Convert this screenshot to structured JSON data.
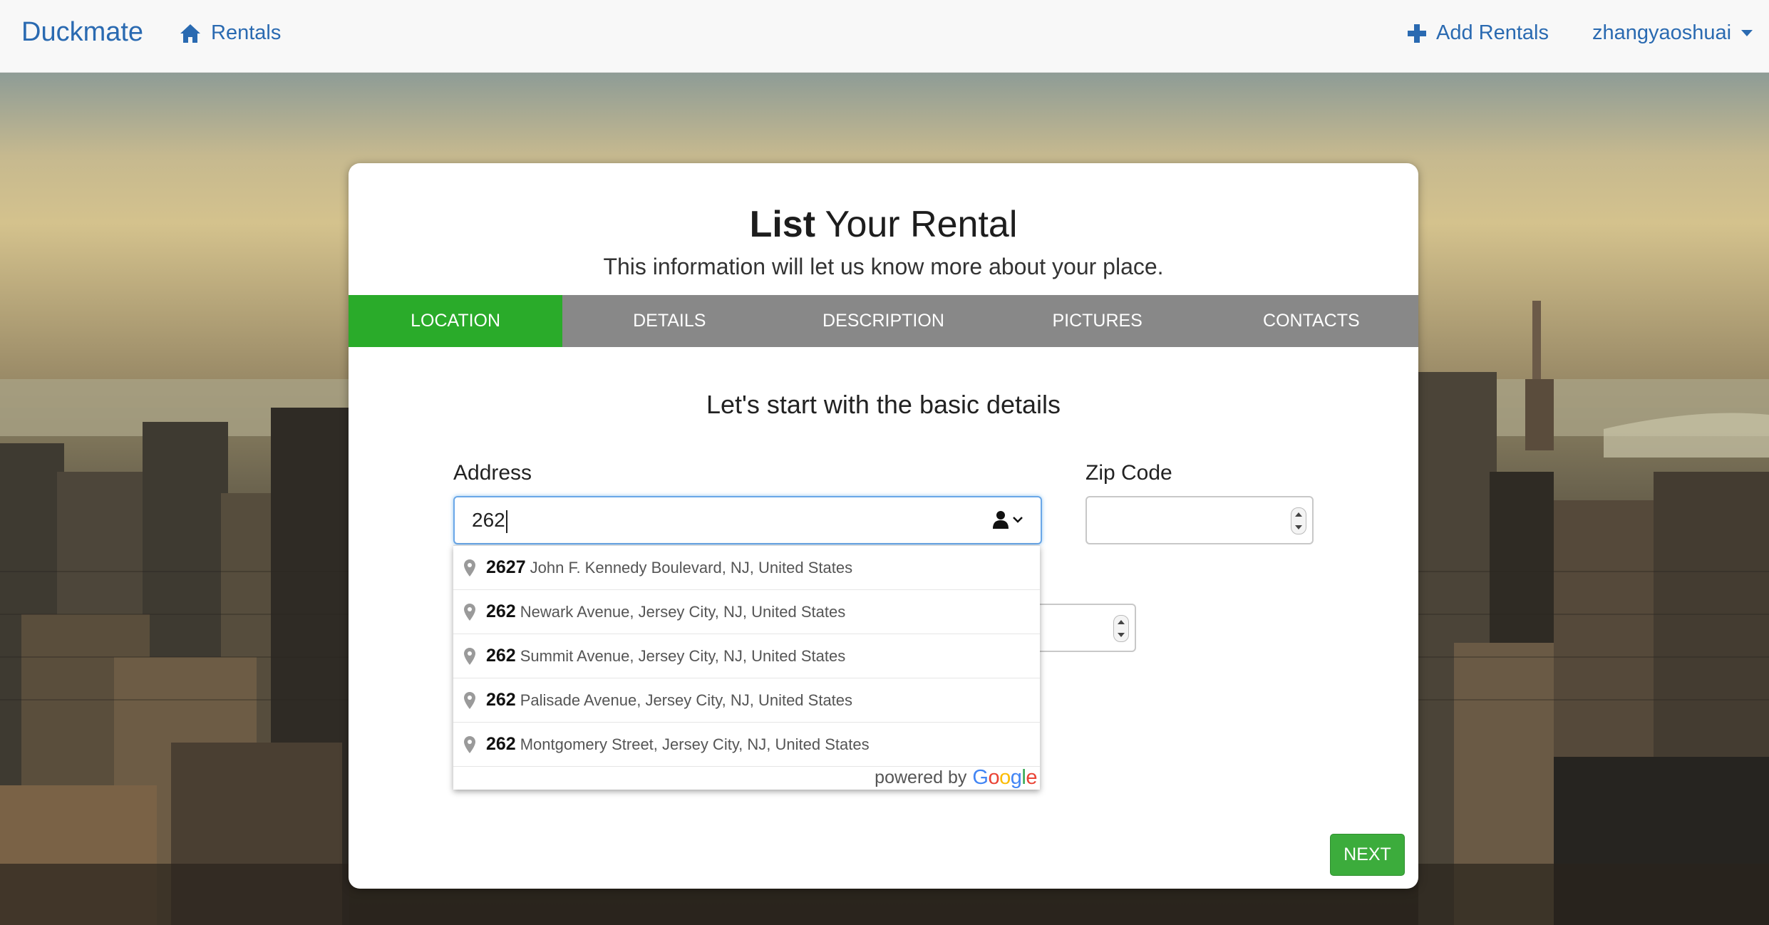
{
  "navbar": {
    "brand": "Duckmate",
    "rentals_label": "Rentals",
    "add_rentals_label": "Add Rentals",
    "user_label": "zhangyaoshuai"
  },
  "card": {
    "title_strong": "List",
    "title_rest": " Your Rental",
    "subtitle": "This information will let us know more about your place."
  },
  "tabs": [
    {
      "label": "LOCATION",
      "active": true
    },
    {
      "label": "DETAILS",
      "active": false
    },
    {
      "label": "DESCRIPTION",
      "active": false
    },
    {
      "label": "PICTURES",
      "active": false
    },
    {
      "label": "CONTACTS",
      "active": false
    }
  ],
  "form": {
    "heading": "Let's start with the basic details",
    "address_label": "Address",
    "address_value": "262",
    "zip_label": "Zip Code",
    "zip_value": ""
  },
  "autocomplete": {
    "items": [
      {
        "match": "2627",
        "rest": "John F. Kennedy Boulevard, NJ, United States"
      },
      {
        "match": "262",
        "rest": "Newark Avenue, Jersey City, NJ, United States"
      },
      {
        "match": "262",
        "rest": "Summit Avenue, Jersey City, NJ, United States"
      },
      {
        "match": "262",
        "rest": "Palisade Avenue, Jersey City, NJ, United States"
      },
      {
        "match": "262",
        "rest": "Montgomery Street, Jersey City, NJ, United States"
      }
    ],
    "powered_by": "powered by",
    "google_letters": [
      "G",
      "o",
      "o",
      "g",
      "l",
      "e"
    ],
    "google_colors": [
      "#4285f4",
      "#ea4335",
      "#fbbc05",
      "#4285f4",
      "#34a853",
      "#ea4335"
    ]
  },
  "buttons": {
    "next_label": "NEXT"
  },
  "colors": {
    "brand": "#2a6ab1",
    "active_tab": "#2aab2a",
    "tab_bar": "#888888",
    "next_button": "#3cac3c"
  }
}
